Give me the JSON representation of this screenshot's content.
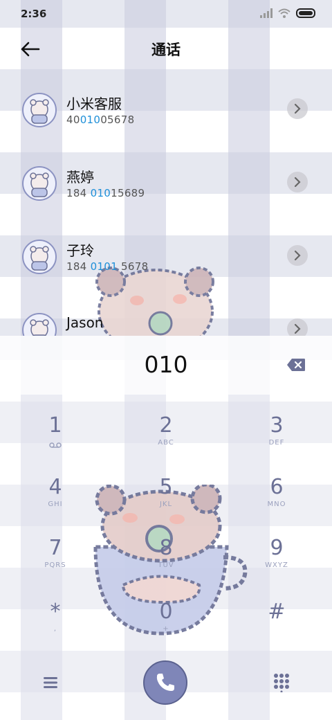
{
  "status_bar": {
    "time": "2:36"
  },
  "header": {
    "title": "通话"
  },
  "contacts": [
    {
      "name": "小米客服",
      "number_pre": "40",
      "number_hl": "010",
      "number_post": "05678"
    },
    {
      "name": "燕婷",
      "number_pre": "184 ",
      "number_hl": "010",
      "number_post": "15689"
    },
    {
      "name": "子玲",
      "number_pre": "184 ",
      "number_hl": "0101",
      "number_post": " 5678"
    },
    {
      "name": "Jason",
      "number_pre": "",
      "number_hl": "",
      "number_post": ""
    }
  ],
  "dialer": {
    "input": "010"
  },
  "keys": [
    {
      "digit": "1",
      "letters": ""
    },
    {
      "digit": "2",
      "letters": "ABC"
    },
    {
      "digit": "3",
      "letters": "DEF"
    },
    {
      "digit": "4",
      "letters": "GHI"
    },
    {
      "digit": "5",
      "letters": "JKL"
    },
    {
      "digit": "6",
      "letters": "MNO"
    },
    {
      "digit": "7",
      "letters": "PQRS"
    },
    {
      "digit": "8",
      "letters": "TUV"
    },
    {
      "digit": "9",
      "letters": "WXYZ"
    },
    {
      "digit": "*",
      "letters": ","
    },
    {
      "digit": "0",
      "letters": "+"
    },
    {
      "digit": "#",
      "letters": ""
    }
  ],
  "colors": {
    "accent": "#7f86b8",
    "highlight": "#1e8fd8",
    "key_digit": "#6c7196"
  }
}
